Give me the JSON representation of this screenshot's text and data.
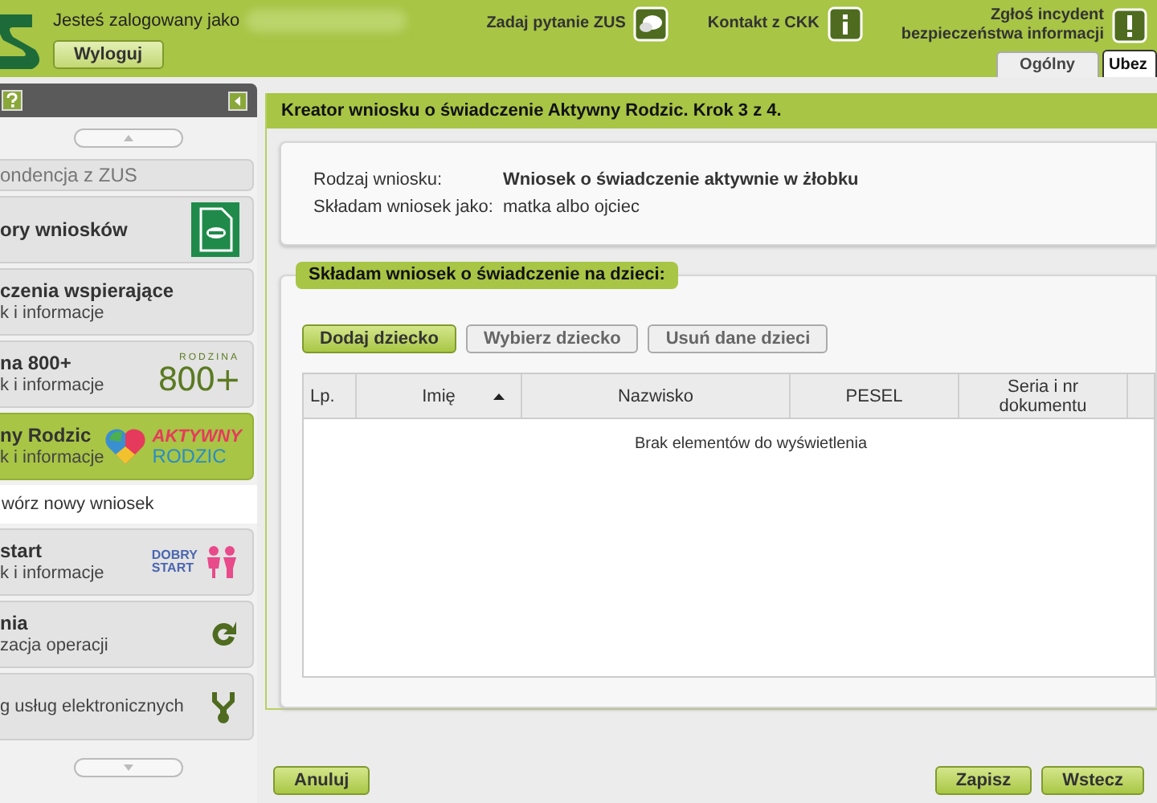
{
  "header": {
    "login_label": "Jesteś zalogowany jako",
    "logout": "Wyloguj",
    "links": [
      {
        "lines": [
          "Zadaj pytanie ZUS"
        ],
        "kind": "chat"
      },
      {
        "lines": [
          "Kontakt z CKK"
        ],
        "kind": "info"
      },
      {
        "lines": [
          "Zgłoś incydent",
          "bezpieczeństwa informacji"
        ],
        "kind": "alert"
      }
    ],
    "tabs": [
      {
        "label": "Ogólny",
        "selected": false
      },
      {
        "label": "Ubez",
        "selected": true
      }
    ]
  },
  "sidebar": {
    "items": [
      {
        "kind": "item",
        "title": "ondencja z ZUS",
        "selected": false
      },
      {
        "kind": "item",
        "title": "ory wniosków",
        "selected": false,
        "logo": {
          "kind": "document"
        }
      },
      {
        "kind": "item",
        "title": "czenia wspierające",
        "subtitle": "k i informacje",
        "selected": false
      },
      {
        "kind": "item",
        "title": "na 800+",
        "subtitle": "k i informacje",
        "selected": false,
        "logo": {
          "kind": "rodzina",
          "text": [
            "RODZINA",
            "800+"
          ]
        }
      },
      {
        "kind": "item",
        "title": "ny Rodzic",
        "subtitle": "k i informacje",
        "selected": true,
        "logo": {
          "kind": "aktywny",
          "text": [
            "AKTYWNY",
            "RODZIC"
          ]
        }
      },
      {
        "kind": "subitem",
        "title": "wórz nowy wniosek",
        "selected": false
      },
      {
        "kind": "item",
        "title": "start",
        "subtitle": "k i informacje",
        "selected": false,
        "logo": {
          "kind": "dobry",
          "text": [
            "DOBRY",
            "START"
          ]
        }
      },
      {
        "kind": "item",
        "title": "nia",
        "subtitle": "zacja operacji",
        "selected": false,
        "logo": {
          "kind": "refresh"
        }
      },
      {
        "kind": "item",
        "subtitle": "g usług elektronicznych",
        "selected": false,
        "logo": {
          "kind": "network"
        }
      }
    ]
  },
  "main": {
    "title": "Kreator wniosku o świadczenie Aktywny Rodzic. Krok 3 z 4.",
    "info": [
      {
        "label": "Rodzaj wniosku:",
        "value": "Wniosek o świadczenie aktywnie w żłobku",
        "bold": true
      },
      {
        "label": "Składam wniosek jako:",
        "value": "matka albo ojciec",
        "bold": false
      }
    ],
    "section_title": "Składam wniosek o świadczenie na dzieci:",
    "buttons": [
      {
        "label": "Dodaj dziecko",
        "disabled": false
      },
      {
        "label": "Wybierz dziecko",
        "disabled": true
      },
      {
        "label": "Usuń dane dzieci",
        "disabled": true
      }
    ],
    "table": {
      "columns": [
        {
          "label": "Lp.",
          "sorted": false
        },
        {
          "label": "Imię",
          "sorted": true
        },
        {
          "label": "Nazwisko",
          "sorted": false
        },
        {
          "label": "PESEL",
          "sorted": false
        },
        {
          "label": "Seria i nr dokumentu",
          "sorted": false
        }
      ],
      "empty": "Brak elementów do wyświetlenia"
    }
  },
  "footer": {
    "left": [
      "Anuluj"
    ],
    "right": [
      "Zapisz",
      "Wstecz"
    ]
  }
}
